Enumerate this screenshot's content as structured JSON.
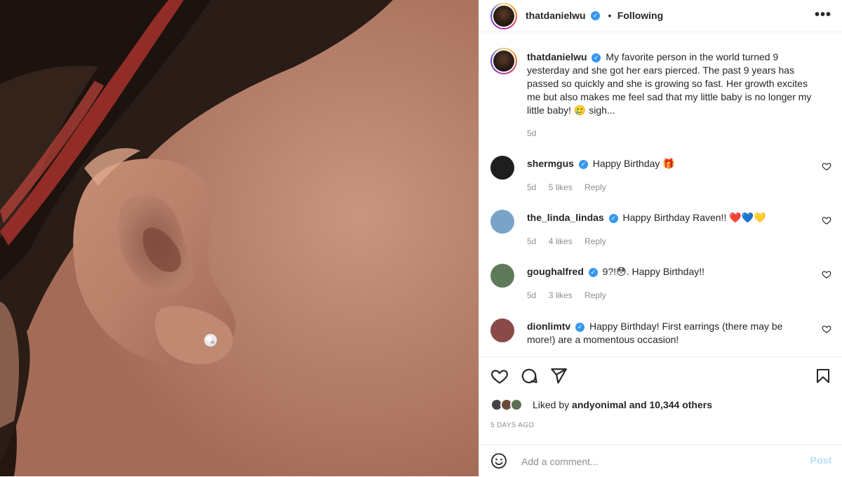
{
  "post": {
    "author": "thatdanielwu",
    "follow_status": "Following",
    "separator": "•",
    "more": "•••",
    "verified_mark": "✓",
    "caption": "My favorite person in the world turned 9 yesterday and she got her ears pierced. The past 9 years has passed so quickly and she is growing so fast. Her growth excites me but also makes me feel sad that my little baby is no longer my little baby! 🥲 sigh...",
    "caption_age": "5d"
  },
  "comments": [
    {
      "user": "shermgus",
      "text": "Happy Birthday 🎁",
      "age": "5d",
      "likes": "5 likes",
      "reply": "Reply",
      "avatar_color": "#1e1e1e"
    },
    {
      "user": "the_linda_lindas",
      "text": "Happy Birthday Raven!! ❤️💙💛",
      "age": "5d",
      "likes": "4 likes",
      "reply": "Reply",
      "avatar_color": "#7aa3c8"
    },
    {
      "user": "goughalfred",
      "text": "9?!😳. Happy Birthday!!",
      "age": "5d",
      "likes": "3 likes",
      "reply": "Reply",
      "avatar_color": "#5f7a5a"
    },
    {
      "user": "dionlimtv",
      "text": "Happy Birthday! First earrings (there may be more!) are a momentous occasion!",
      "age": "",
      "likes": "",
      "reply": "",
      "avatar_color": "#8a4a4a"
    }
  ],
  "likes": {
    "text_prefix": "Liked by ",
    "liker": "andyonimal",
    "text_suffix": " and 10,344 others"
  },
  "post_date": "5 DAYS AGO",
  "comment_box": {
    "placeholder": "Add a comment...",
    "post_label": "Post",
    "emoji_icon": "smiley-icon"
  },
  "colors": {
    "verified": "#3897f0",
    "post_button_disabled": "#b2dffc",
    "meta_gray": "#8e8e8e"
  }
}
